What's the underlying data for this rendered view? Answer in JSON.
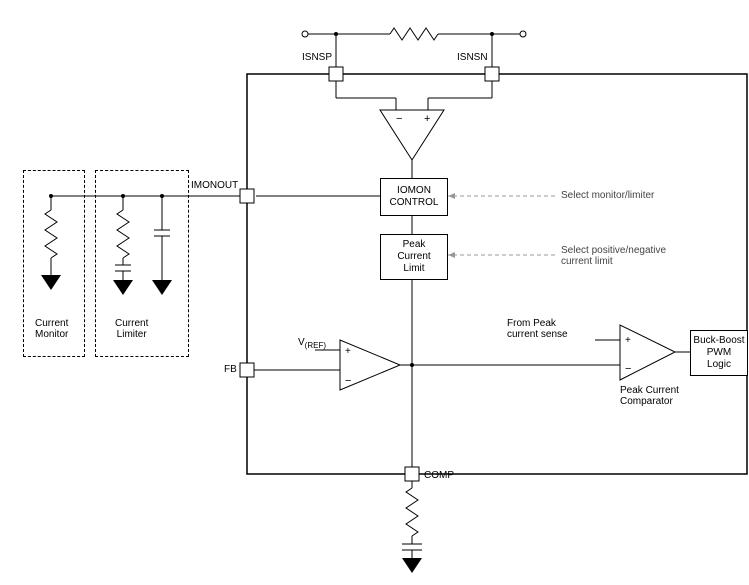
{
  "pins": {
    "isnsp": "ISNSP",
    "isnsn": "ISNSN",
    "imonout": "IMONOUT",
    "fb": "FB",
    "comp": "COMP"
  },
  "blocks": {
    "iomon_control": "IOMON\nCONTROL",
    "peak_current_limit": "Peak\nCurrent\nLimit",
    "buck_boost": "Buck-Boost\nPWM\nLogic",
    "current_monitor": "Current\nMonitor",
    "current_limiter": "Current\nLimiter"
  },
  "labels": {
    "vref": "V",
    "vref_sub": "(REF)",
    "peak_comparator": "Peak Current\nComparator",
    "from_peak": "From Peak\ncurrent sense",
    "select_monitor": "Select monitor/limiter",
    "select_polarity": "Select positive/negative\ncurrent limit"
  }
}
